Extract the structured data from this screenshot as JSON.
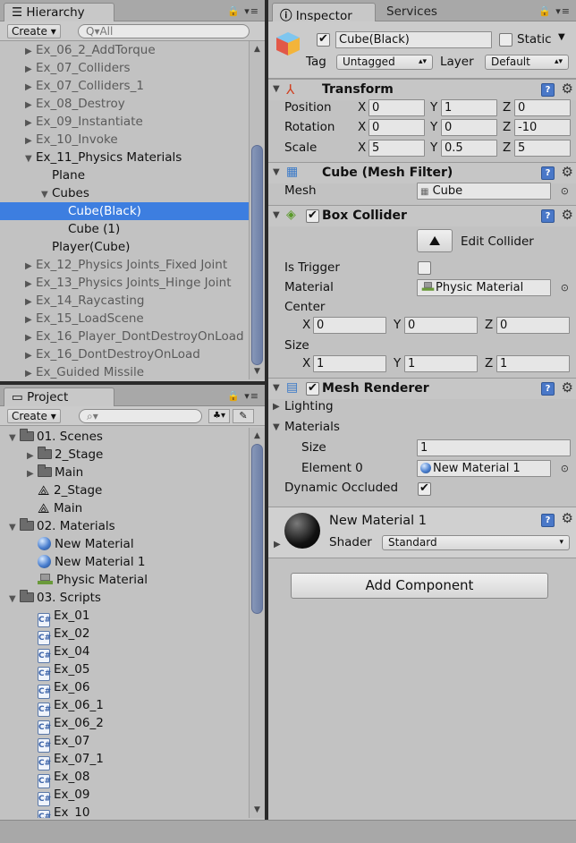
{
  "hierarchy": {
    "tab_label": "Hierarchy",
    "create_label": "Create ▾",
    "search_placeholder": "Q▾All",
    "items": [
      {
        "label": "Ex_06_2_AddTorque",
        "indent": 0,
        "arrow": "▶",
        "gray": true
      },
      {
        "label": "Ex_07_Colliders",
        "indent": 0,
        "arrow": "▶",
        "gray": true
      },
      {
        "label": "Ex_07_Colliders_1",
        "indent": 0,
        "arrow": "▶",
        "gray": true
      },
      {
        "label": "Ex_08_Destroy",
        "indent": 0,
        "arrow": "▶",
        "gray": true
      },
      {
        "label": "Ex_09_Instantiate",
        "indent": 0,
        "arrow": "▶",
        "gray": true
      },
      {
        "label": "Ex_10_Invoke",
        "indent": 0,
        "arrow": "▶",
        "gray": true
      },
      {
        "label": "Ex_11_Physics Materials",
        "indent": 0,
        "arrow": "▼",
        "gray": false
      },
      {
        "label": "Plane",
        "indent": 1,
        "arrow": "",
        "gray": false
      },
      {
        "label": "Cubes",
        "indent": 1,
        "arrow": "▼",
        "gray": false
      },
      {
        "label": "Cube(Black)",
        "indent": 2,
        "arrow": "",
        "gray": false,
        "selected": true
      },
      {
        "label": "Cube (1)",
        "indent": 2,
        "arrow": "",
        "gray": false
      },
      {
        "label": "Player(Cube)",
        "indent": 1,
        "arrow": "",
        "gray": false
      },
      {
        "label": "Ex_12_Physics Joints_Fixed Joint",
        "indent": 0,
        "arrow": "▶",
        "gray": true
      },
      {
        "label": "Ex_13_Physics Joints_Hinge Joint",
        "indent": 0,
        "arrow": "▶",
        "gray": true
      },
      {
        "label": "Ex_14_Raycasting",
        "indent": 0,
        "arrow": "▶",
        "gray": true
      },
      {
        "label": "Ex_15_LoadScene",
        "indent": 0,
        "arrow": "▶",
        "gray": true
      },
      {
        "label": "Ex_16_Player_DontDestroyOnLoad",
        "indent": 0,
        "arrow": "▶",
        "gray": true
      },
      {
        "label": "Ex_16_DontDestroyOnLoad",
        "indent": 0,
        "arrow": "▶",
        "gray": true
      },
      {
        "label": "Ex_Guided Missile",
        "indent": 0,
        "arrow": "▶",
        "gray": true
      }
    ]
  },
  "project": {
    "tab_label": "Project",
    "create_label": "Create ▾",
    "search_placeholder": "",
    "items": [
      {
        "label": "01. Scenes",
        "indent": 0,
        "arrow": "▼",
        "icon": "folder"
      },
      {
        "label": "2_Stage",
        "indent": 1,
        "arrow": "▶",
        "icon": "folder"
      },
      {
        "label": "Main",
        "indent": 1,
        "arrow": "▶",
        "icon": "folder"
      },
      {
        "label": "2_Stage",
        "indent": 1,
        "arrow": "",
        "icon": "unity"
      },
      {
        "label": "Main",
        "indent": 1,
        "arrow": "",
        "icon": "unity"
      },
      {
        "label": "02. Materials",
        "indent": 0,
        "arrow": "▼",
        "icon": "folder"
      },
      {
        "label": "New Material",
        "indent": 1,
        "arrow": "",
        "icon": "sphere"
      },
      {
        "label": "New Material 1",
        "indent": 1,
        "arrow": "",
        "icon": "sphere"
      },
      {
        "label": "Physic Material",
        "indent": 1,
        "arrow": "",
        "icon": "physic"
      },
      {
        "label": "03. Scripts",
        "indent": 0,
        "arrow": "▼",
        "icon": "folder"
      },
      {
        "label": "Ex_01",
        "indent": 1,
        "arrow": "",
        "icon": "cs"
      },
      {
        "label": "Ex_02",
        "indent": 1,
        "arrow": "",
        "icon": "cs"
      },
      {
        "label": "Ex_04",
        "indent": 1,
        "arrow": "",
        "icon": "cs"
      },
      {
        "label": "Ex_05",
        "indent": 1,
        "arrow": "",
        "icon": "cs"
      },
      {
        "label": "Ex_06",
        "indent": 1,
        "arrow": "",
        "icon": "cs"
      },
      {
        "label": "Ex_06_1",
        "indent": 1,
        "arrow": "",
        "icon": "cs"
      },
      {
        "label": "Ex_06_2",
        "indent": 1,
        "arrow": "",
        "icon": "cs"
      },
      {
        "label": "Ex_07",
        "indent": 1,
        "arrow": "",
        "icon": "cs"
      },
      {
        "label": "Ex_07_1",
        "indent": 1,
        "arrow": "",
        "icon": "cs"
      },
      {
        "label": "Ex_08",
        "indent": 1,
        "arrow": "",
        "icon": "cs"
      },
      {
        "label": "Ex_09",
        "indent": 1,
        "arrow": "",
        "icon": "cs"
      },
      {
        "label": "Ex_10",
        "indent": 1,
        "arrow": "",
        "icon": "cs"
      }
    ]
  },
  "inspector": {
    "tab_label": "Inspector",
    "services_label": "Services",
    "object_name": "Cube(Black)",
    "static_label": "Static",
    "tag_label": "Tag",
    "tag_value": "Untagged",
    "layer_label": "Layer",
    "layer_value": "Default",
    "transform": {
      "title": "Transform",
      "position_label": "Position",
      "rotation_label": "Rotation",
      "scale_label": "Scale",
      "position": {
        "x": "0",
        "y": "1",
        "z": "0"
      },
      "rotation": {
        "x": "0",
        "y": "0",
        "z": "-10"
      },
      "scale": {
        "x": "5",
        "y": "0.5",
        "z": "5"
      }
    },
    "mesh_filter": {
      "title": "Cube (Mesh Filter)",
      "mesh_label": "Mesh",
      "mesh_value": "Cube"
    },
    "box_collider": {
      "title": "Box Collider",
      "edit_label": "Edit Collider",
      "is_trigger_label": "Is Trigger",
      "material_label": "Material",
      "material_value": "Physic Material",
      "center_label": "Center",
      "size_label": "Size",
      "center": {
        "x": "0",
        "y": "0",
        "z": "0"
      },
      "size": {
        "x": "1",
        "y": "1",
        "z": "1"
      }
    },
    "mesh_renderer": {
      "title": "Mesh Renderer",
      "lighting_label": "Lighting",
      "materials_label": "Materials",
      "size_label": "Size",
      "size_value": "1",
      "element_label": "Element 0",
      "element_value": "New Material 1",
      "dynamic_label": "Dynamic Occluded"
    },
    "material": {
      "name": "New Material 1",
      "shader_label": "Shader",
      "shader_value": "Standard"
    },
    "add_component_label": "Add Component",
    "axis": {
      "x": "X",
      "y": "Y",
      "z": "Z"
    },
    "colors": {
      "help": "#4a78c8",
      "selected": "#3d7ee0"
    }
  }
}
